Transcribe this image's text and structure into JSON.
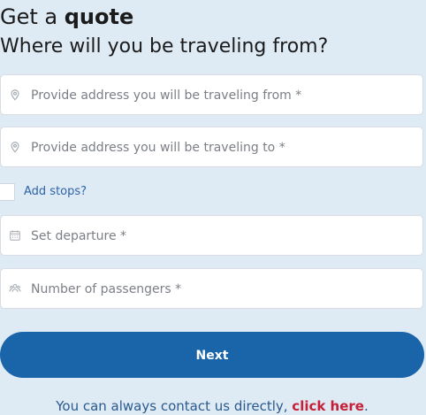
{
  "header": {
    "title_prefix": "Get a ",
    "title_emphasis": "quote",
    "subtitle": "Where will you be traveling from?"
  },
  "fields": {
    "from_placeholder": "Provide address you will be traveling from *",
    "to_placeholder": "Provide address you will be traveling to *",
    "departure_placeholder": "Set departure *",
    "passengers_placeholder": "Number of passengers *"
  },
  "stops": {
    "label": "Add stops?",
    "checked": false
  },
  "actions": {
    "next_label": "Next"
  },
  "contact": {
    "text_before": "You can always contact us directly, ",
    "link_text": "click here",
    "text_after": "."
  },
  "colors": {
    "page_background": "#deeaf4",
    "field_background": "#ffffff",
    "placeholder_text": "#7b7f86",
    "primary_button": "#1a64aa",
    "accent_link": "#c61f36",
    "secondary_link": "#2e63a8"
  },
  "icons": {
    "from": "location-pin-icon",
    "to": "location-pin-icon",
    "departure": "calendar-icon",
    "passengers": "passengers-icon"
  }
}
